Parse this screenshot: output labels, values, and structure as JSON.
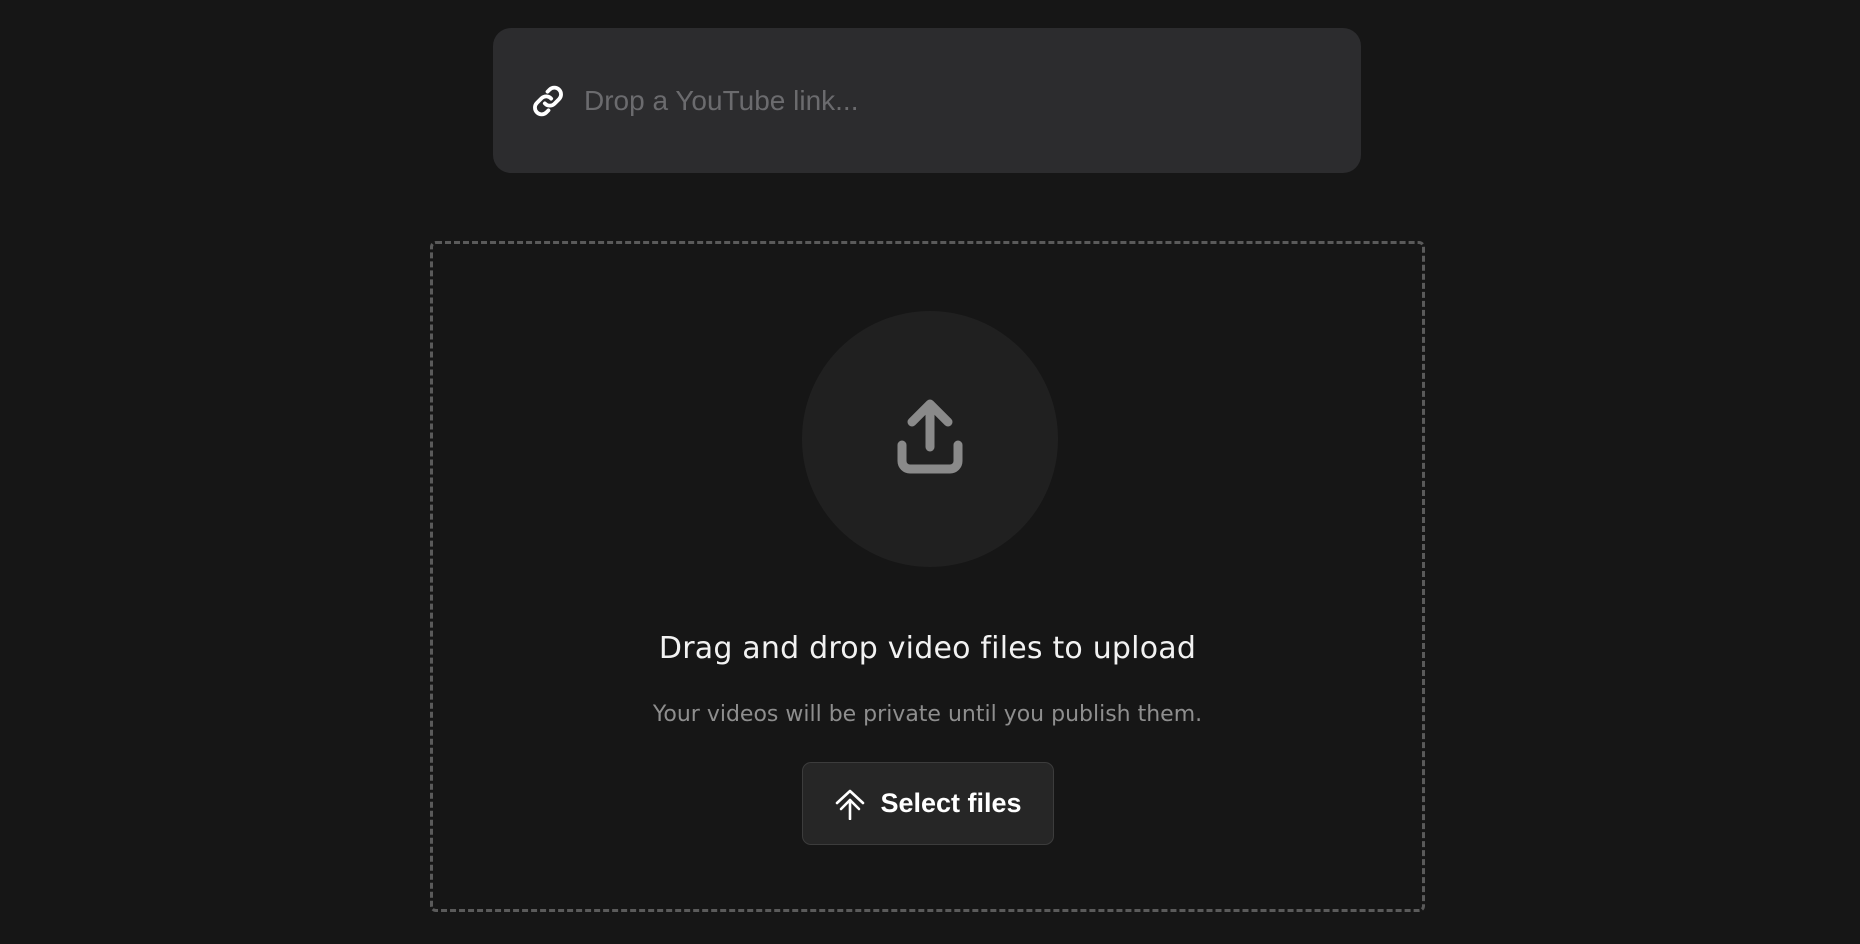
{
  "link_bar": {
    "placeholder": "Drop a YouTube link...",
    "icon": "link-icon"
  },
  "dropzone": {
    "icon": "upload-icon",
    "title": "Drag and drop video files to upload",
    "subtitle": "Your videos will be private until you publish them.",
    "select_button": {
      "label": "Select files",
      "icon": "upload-arrows-icon"
    }
  },
  "colors": {
    "background": "#161616",
    "link_bar_bg": "#2c2c2e",
    "placeholder": "#6b6b6e",
    "dropzone_border": "#5a5a5a",
    "circle_bg": "#202020",
    "icon_gray": "#8a8a8a",
    "subtitle": "#8e8e8e",
    "button_bg": "#262626"
  }
}
